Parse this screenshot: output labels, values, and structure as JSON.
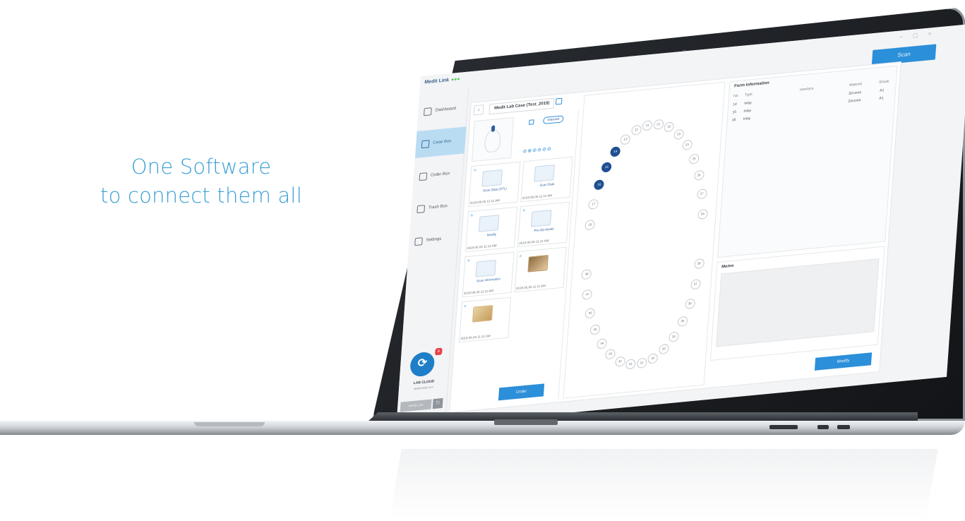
{
  "tagline": {
    "line1": "One Software",
    "line2": "to connect them all"
  },
  "app": {
    "title": "Medit Link",
    "scan_label": "Scan",
    "window_controls": "– ▢ ×"
  },
  "sidebar": {
    "items": [
      {
        "label": "Dashboard",
        "icon": "dashboard-icon"
      },
      {
        "label": "Case Box",
        "icon": "case-box-icon"
      },
      {
        "label": "Order Box",
        "icon": "order-box-icon"
      },
      {
        "label": "Trash Box",
        "icon": "trash-box-icon"
      },
      {
        "label": "Settings",
        "icon": "settings-icon"
      }
    ],
    "cloud_name": "LAB CLOUD",
    "cloud_email": "lab@medit.com",
    "badge": "9",
    "bottom_button": "Medit Link"
  },
  "case": {
    "title": "Medit Lab Case (Test_2019)",
    "internet_label": "Internet",
    "mini_icons": "⊘⊕⊘⊘⊘⊘",
    "files": [
      {
        "label": "Scan Data (STL)",
        "tag": "↻",
        "date": "2019.06.05 11:11 AM"
      },
      {
        "label": "Scan Data",
        "tag": "",
        "date": "2019.06.05 11:11 AM"
      },
      {
        "label": "Modify",
        "tag": "↻",
        "date": "2019.06.05 11:11 AM"
      },
      {
        "label": "Pre-Op Model",
        "tag": "↻",
        "date": "2019.06.05 11:11 AM"
      },
      {
        "label": "Scan Information",
        "tag": "↻",
        "date": "2019.06.05 11:11 AM"
      },
      {
        "label": "",
        "tag": "⌀",
        "date": "2019.06.05 11:11 AM"
      },
      {
        "label": "",
        "tag": "⌀",
        "date": "2019.06.05 11:11 AM"
      }
    ],
    "order_label": "Order"
  },
  "teeth": {
    "upper": [
      "18",
      "17",
      "16",
      "15",
      "14",
      "13",
      "12",
      "11",
      "21",
      "22",
      "23",
      "24",
      "25",
      "26",
      "27",
      "28"
    ],
    "lower": [
      "48",
      "47",
      "46",
      "45",
      "44",
      "43",
      "42",
      "41",
      "31",
      "32",
      "33",
      "34",
      "35",
      "36",
      "37",
      "38"
    ],
    "selected": [
      "14",
      "15",
      "16"
    ]
  },
  "form": {
    "title": "Form Information",
    "headers": {
      "no": "No.",
      "type": "Type",
      "interface": "Interface",
      "material": "Material",
      "shade": "Shade"
    },
    "rows": [
      {
        "no": "14",
        "type": "Inlay",
        "material": "Zirconia",
        "shade": "A1"
      },
      {
        "no": "15",
        "type": "Inlay",
        "material": "Zirconia",
        "shade": "A1"
      },
      {
        "no": "16",
        "type": "Inlay",
        "material": "Zirconia",
        "shade": "A1"
      }
    ],
    "notes_title": "Memo",
    "modify_label": "Modify"
  },
  "colors": {
    "accent": "#2c8fd9",
    "tagline": "#3a9fd4",
    "selected_tooth": "#1f4f92"
  }
}
